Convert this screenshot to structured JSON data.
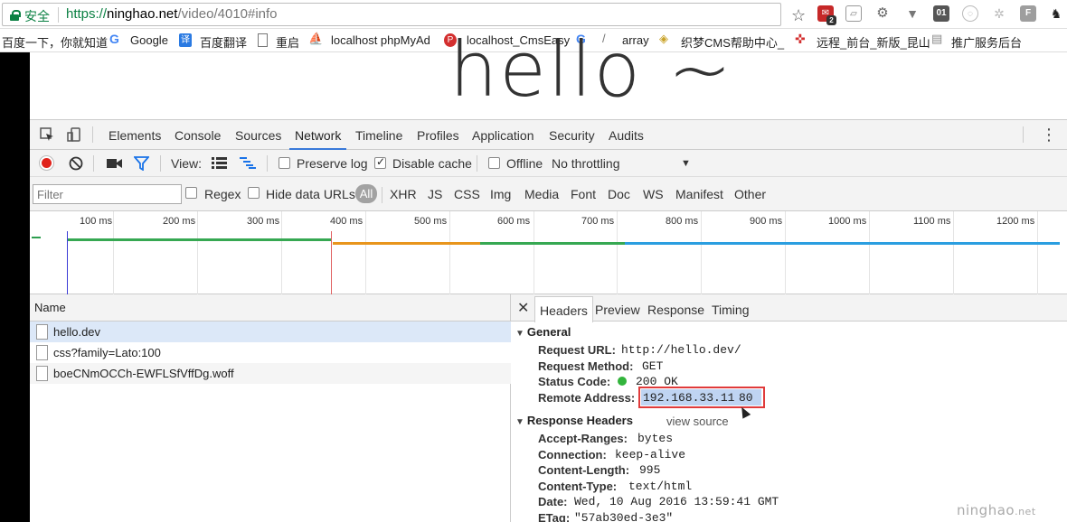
{
  "browser": {
    "secure_label": "安全",
    "url_scheme": "https://",
    "url_host": "ninghao.net",
    "url_path": "/video/4010#info",
    "ext_badge": "2",
    "ext_label_01": "01",
    "ext_label_f": "F"
  },
  "bookmarks": [
    {
      "label": "百度一下，你就知道"
    },
    {
      "label": "Google"
    },
    {
      "label": "百度翻译"
    },
    {
      "label": "重启"
    },
    {
      "label": "localhost phpMyAd"
    },
    {
      "label": "localhost_CmsEasy"
    },
    {
      "label": "array"
    },
    {
      "label": "织梦CMS帮助中心_"
    },
    {
      "label": "远程_前台_新版_昆山"
    },
    {
      "label": "推广服务后台"
    }
  ],
  "page": {
    "heading": "hello ~"
  },
  "devtools": {
    "tabs": [
      "Elements",
      "Console",
      "Sources",
      "Network",
      "Timeline",
      "Profiles",
      "Application",
      "Security",
      "Audits"
    ],
    "active_tab": "Network",
    "toolbar": {
      "view_label": "View:",
      "preserve_log": "Preserve log",
      "disable_cache": "Disable cache",
      "offline": "Offline",
      "throttling": "No throttling"
    },
    "filter": {
      "placeholder": "Filter",
      "regex": "Regex",
      "hide_data_urls": "Hide data URLs",
      "types": [
        "All",
        "XHR",
        "JS",
        "CSS",
        "Img",
        "Media",
        "Font",
        "Doc",
        "WS",
        "Manifest",
        "Other"
      ]
    },
    "overview_ticks": [
      "100 ms",
      "200 ms",
      "300 ms",
      "400 ms",
      "500 ms",
      "600 ms",
      "700 ms",
      "800 ms",
      "900 ms",
      "1000 ms",
      "1100 ms",
      "1200 ms"
    ],
    "requests_header": "Name",
    "requests": [
      "hello.dev",
      "css?family=Lato:100",
      "boeCNmOCCh-EWFLSfVffDg.woff"
    ],
    "detail_tabs": [
      "Headers",
      "Preview",
      "Response",
      "Timing"
    ],
    "general": {
      "title": "General",
      "request_url_key": "Request URL:",
      "request_url": "http://hello.dev/",
      "method_key": "Request Method:",
      "method": "GET",
      "status_key": "Status Code:",
      "status": "200 OK",
      "remote_key": "Remote Address:",
      "remote_ip": "192.168.33.11",
      "remote_port": "80"
    },
    "response_headers": {
      "title": "Response Headers",
      "view_source": "view source",
      "items": [
        {
          "key": "Accept-Ranges:",
          "value": "bytes"
        },
        {
          "key": "Connection:",
          "value": "keep-alive"
        },
        {
          "key": "Content-Length:",
          "value": "995"
        },
        {
          "key": "Content-Type:",
          "value": "text/html"
        },
        {
          "key": "Date:",
          "value": "Wed, 10 Aug 2016 13:59:41 GMT"
        },
        {
          "key": "ETag:",
          "value": "\"57ab30ed-3e3\""
        }
      ]
    }
  },
  "watermark": {
    "text": "ninghao",
    "suffix": ".net"
  }
}
